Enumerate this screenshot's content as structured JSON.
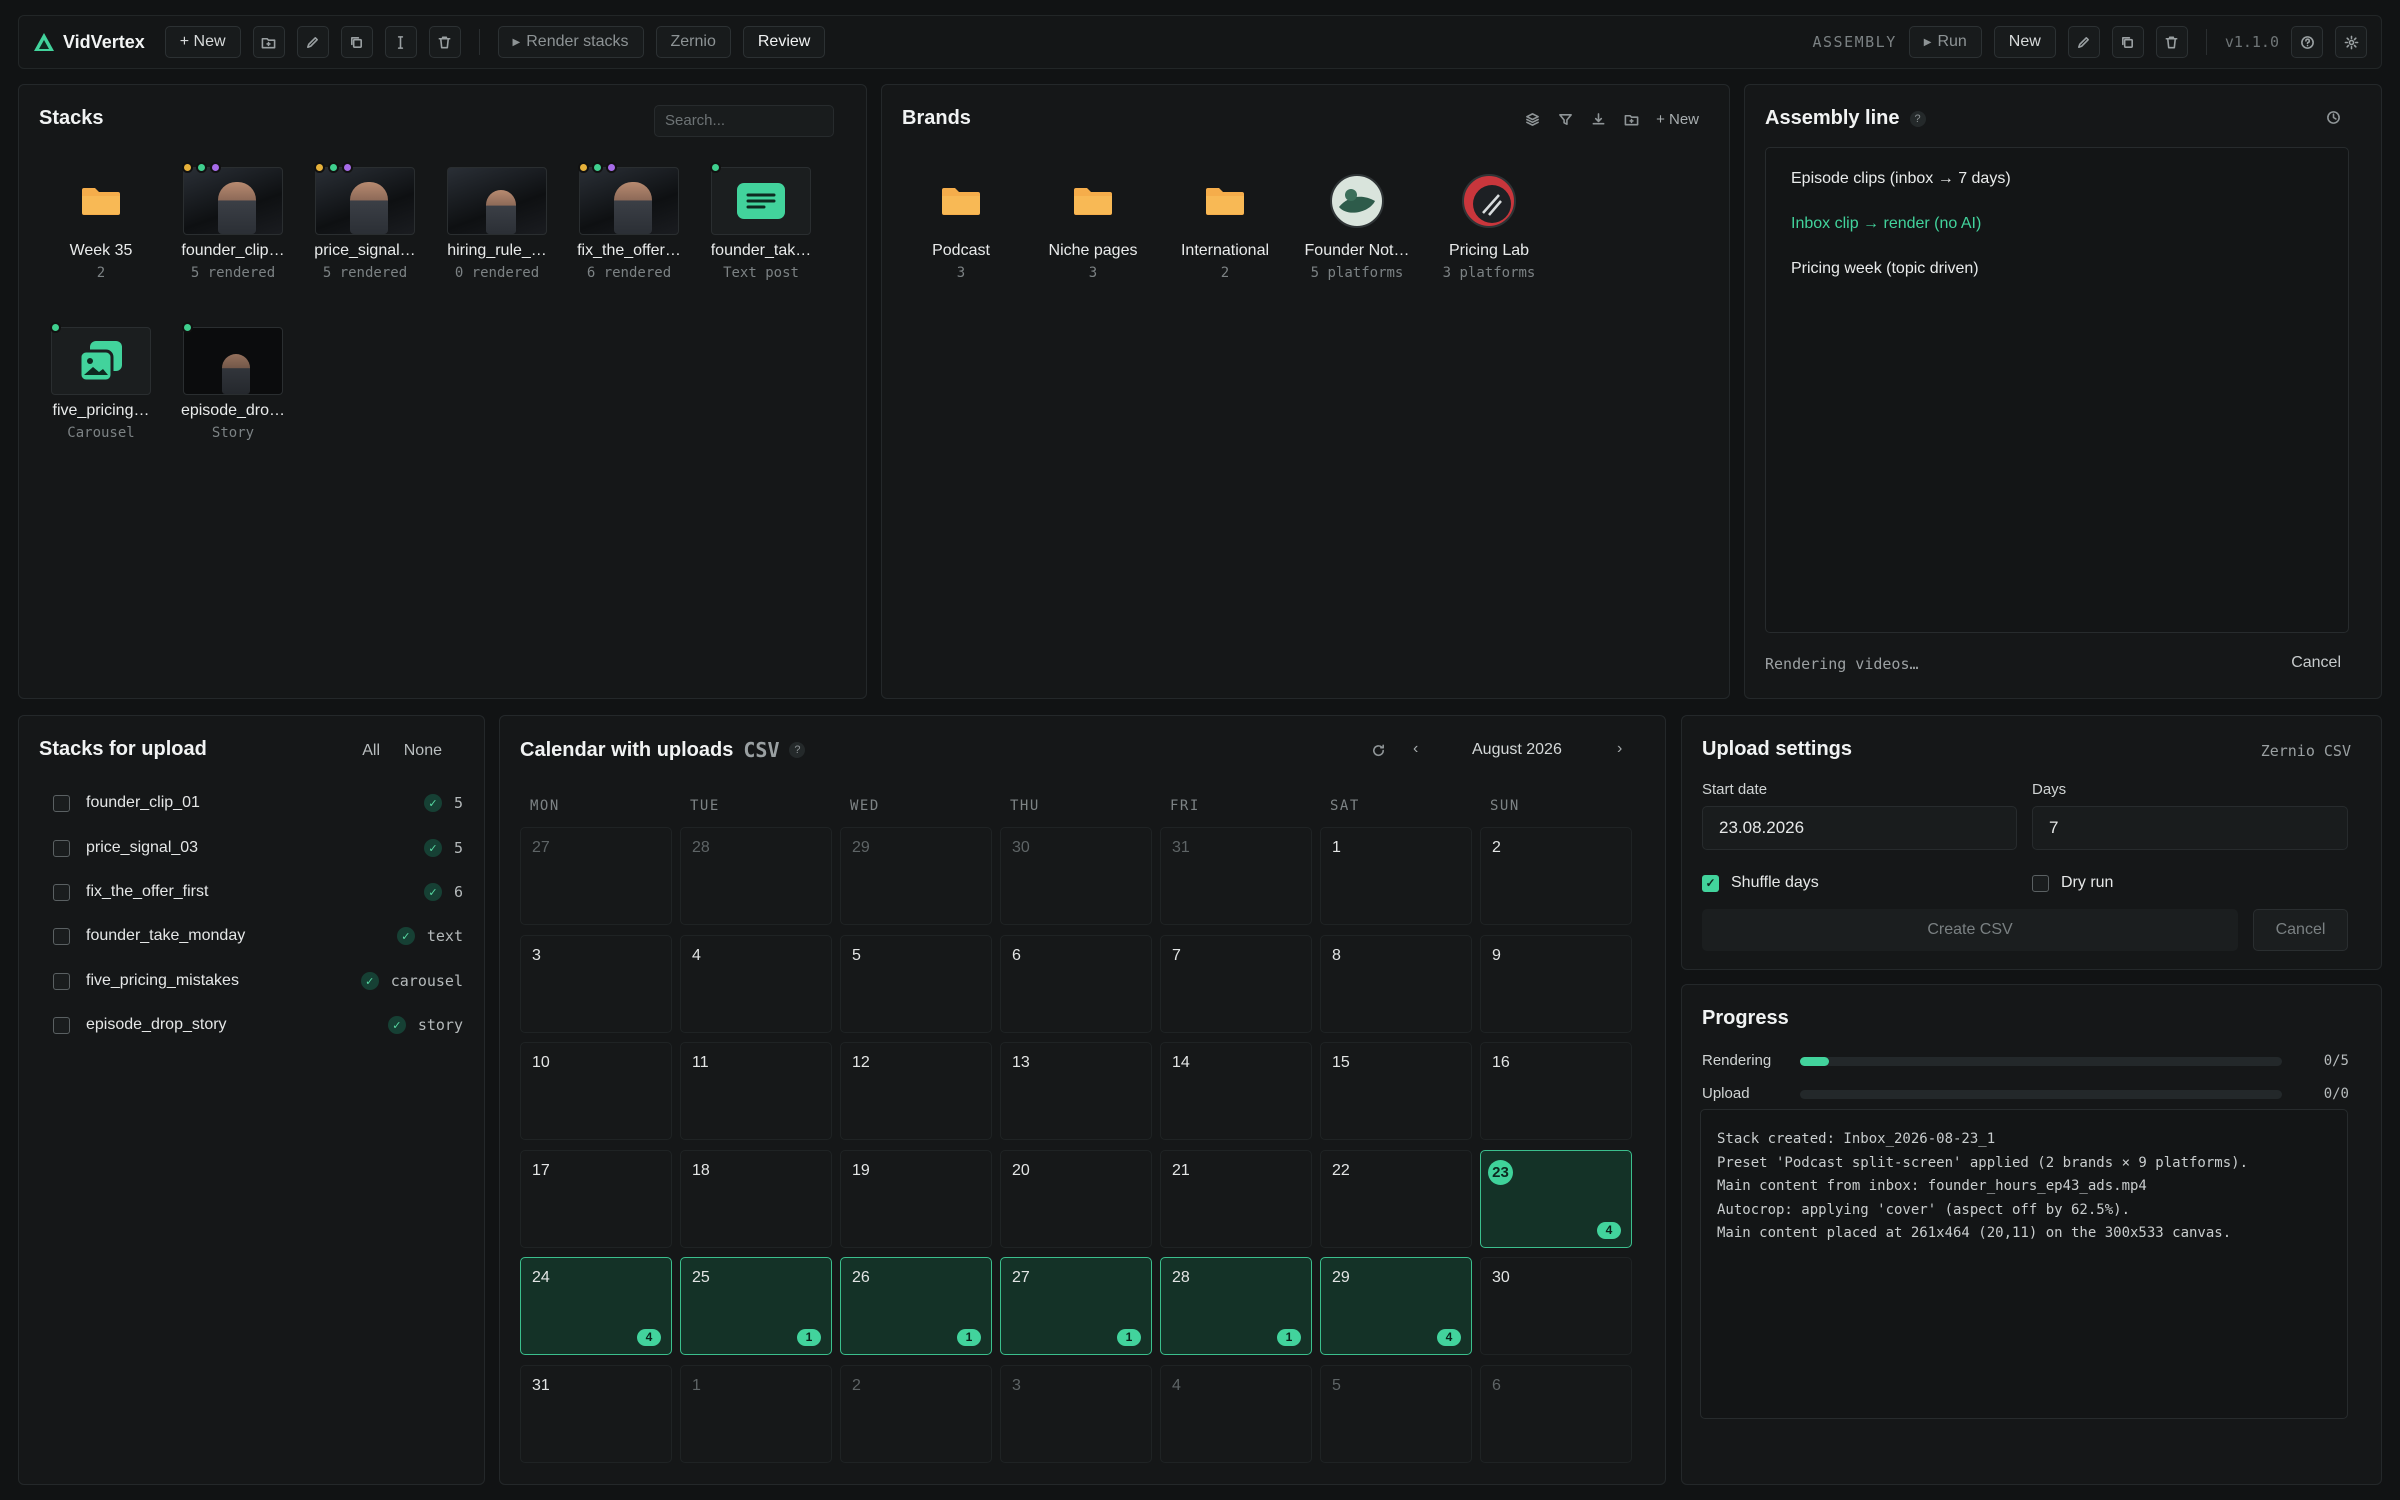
{
  "app": {
    "name": "VidVertex",
    "version": "v1.1.0"
  },
  "toolbar": {
    "new_label": "+ New",
    "render_stacks_label": "Render stacks",
    "zernio_label": "Zernio",
    "review_label": "Review",
    "assembly_label": "ASSEMBLY",
    "run_label": "Run",
    "new_right_label": "New"
  },
  "stacks": {
    "title": "Stacks",
    "search_placeholder": "Search...",
    "items": [
      {
        "name": "Week 35",
        "sub": "2",
        "kind": "folder"
      },
      {
        "name": "founder_clip…",
        "sub": "5 rendered",
        "kind": "video",
        "dots": [
          "#e6b13a",
          "#3fcf8e",
          "#a66be8"
        ]
      },
      {
        "name": "price_signal…",
        "sub": "5 rendered",
        "kind": "video",
        "dots": [
          "#e6b13a",
          "#3fcf8e",
          "#a66be8"
        ]
      },
      {
        "name": "hiring_rule_…",
        "sub": "0 rendered",
        "kind": "video",
        "dots": []
      },
      {
        "name": "fix_the_offer…",
        "sub": "6 rendered",
        "kind": "video",
        "dots": [
          "#e6b13a",
          "#3fcf8e",
          "#a66be8"
        ]
      },
      {
        "name": "founder_tak…",
        "sub": "Text post",
        "kind": "text",
        "dots": [
          "#3fcf8e"
        ]
      },
      {
        "name": "five_pricing…",
        "sub": "Carousel",
        "kind": "carousel",
        "dots": [
          "#3fcf8e"
        ]
      },
      {
        "name": "episode_dro…",
        "sub": "Story",
        "kind": "story",
        "dots": [
          "#3fcf8e"
        ]
      }
    ]
  },
  "brands": {
    "title": "Brands",
    "new_label": "+ New",
    "items": [
      {
        "name": "Podcast",
        "sub": "3",
        "kind": "folder"
      },
      {
        "name": "Niche pages",
        "sub": "3",
        "kind": "folder"
      },
      {
        "name": "International",
        "sub": "2",
        "kind": "folder"
      },
      {
        "name": "Founder Not…",
        "sub": "5 platforms",
        "kind": "avatar1"
      },
      {
        "name": "Pricing Lab",
        "sub": "3 platforms",
        "kind": "avatar2"
      }
    ]
  },
  "assembly": {
    "title": "Assembly line",
    "items": [
      {
        "label": "Episode clips (inbox → 7 days)",
        "active": false
      },
      {
        "label": "Inbox clip → render (no AI)",
        "active": true
      },
      {
        "label": "Pricing week (topic driven)",
        "active": false
      }
    ],
    "status": "Rendering videos…",
    "cancel_label": "Cancel"
  },
  "upload_list": {
    "title": "Stacks for upload",
    "all_label": "All",
    "none_label": "None",
    "items": [
      {
        "name": "founder_clip_01",
        "value": "5"
      },
      {
        "name": "price_signal_03",
        "value": "5"
      },
      {
        "name": "fix_the_offer_first",
        "value": "6"
      },
      {
        "name": "founder_take_monday",
        "value": "text"
      },
      {
        "name": "five_pricing_mistakes",
        "value": "carousel"
      },
      {
        "name": "episode_drop_story",
        "value": "story"
      }
    ]
  },
  "calendar": {
    "title": "Calendar with uploads",
    "csv_label": "CSV",
    "month": "August 2026",
    "weekdays": [
      "MON",
      "TUE",
      "WED",
      "THU",
      "FRI",
      "SAT",
      "SUN"
    ],
    "weeks": [
      [
        {
          "d": "27",
          "out": true
        },
        {
          "d": "28",
          "out": true
        },
        {
          "d": "29",
          "out": true
        },
        {
          "d": "30",
          "out": true
        },
        {
          "d": "31",
          "out": true
        },
        {
          "d": "1"
        },
        {
          "d": "2"
        }
      ],
      [
        {
          "d": "3"
        },
        {
          "d": "4"
        },
        {
          "d": "5"
        },
        {
          "d": "6"
        },
        {
          "d": "7"
        },
        {
          "d": "8"
        },
        {
          "d": "9"
        }
      ],
      [
        {
          "d": "10"
        },
        {
          "d": "11"
        },
        {
          "d": "12"
        },
        {
          "d": "13"
        },
        {
          "d": "14"
        },
        {
          "d": "15"
        },
        {
          "d": "16"
        }
      ],
      [
        {
          "d": "17"
        },
        {
          "d": "18"
        },
        {
          "d": "19"
        },
        {
          "d": "20"
        },
        {
          "d": "21"
        },
        {
          "d": "22"
        },
        {
          "d": "23",
          "count": "4",
          "today": true
        }
      ],
      [
        {
          "d": "24",
          "count": "4"
        },
        {
          "d": "25",
          "count": "1"
        },
        {
          "d": "26",
          "count": "1"
        },
        {
          "d": "27",
          "count": "1"
        },
        {
          "d": "28",
          "count": "1"
        },
        {
          "d": "29",
          "count": "4"
        },
        {
          "d": "30"
        }
      ],
      [
        {
          "d": "31"
        },
        {
          "d": "1",
          "out": true
        },
        {
          "d": "2",
          "out": true
        },
        {
          "d": "3",
          "out": true
        },
        {
          "d": "4",
          "out": true
        },
        {
          "d": "5",
          "out": true
        },
        {
          "d": "6",
          "out": true
        }
      ]
    ]
  },
  "settings": {
    "title": "Upload settings",
    "target": "Zernio CSV",
    "start_date_label": "Start date",
    "start_date": "23.08.2026",
    "days_label": "Days",
    "days": "7",
    "shuffle_label": "Shuffle days",
    "shuffle_checked": true,
    "dry_run_label": "Dry run",
    "dry_run_checked": false,
    "create_label": "Create CSV",
    "cancel_label": "Cancel"
  },
  "progress": {
    "title": "Progress",
    "rendering_label": "Rendering",
    "rendering_value": "0/5",
    "rendering_fraction": 0.06,
    "upload_label": "Upload",
    "upload_value": "0/0",
    "upload_fraction": 0,
    "log": [
      "Stack created: Inbox_2026-08-23_1",
      "Preset 'Podcast split-screen' applied (2 brands × 9 platforms).",
      "Main content from inbox: founder_hours_ep43_ads.mp4",
      "Autocrop: applying 'cover' (aspect off by 62.5%).",
      "Main content placed at 261x464 (20,11) on the 300x533 canvas."
    ]
  },
  "colors": {
    "accent": "#42d39c",
    "folder": "#f5ad4b",
    "background": "#111314"
  }
}
